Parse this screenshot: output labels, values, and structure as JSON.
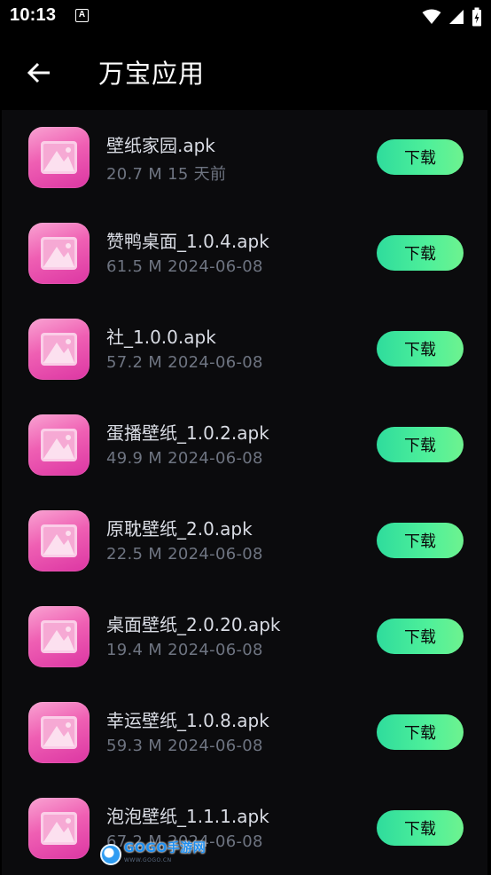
{
  "status_bar": {
    "time": "10:13",
    "notification_icon": "A"
  },
  "header": {
    "title": "万宝应用",
    "back_icon": "arrow-left-icon"
  },
  "items": [
    {
      "name": "壁纸家园.apk",
      "meta": "20.7 M  15 天前",
      "button": "下载"
    },
    {
      "name": "赞鸭桌面_1.0.4.apk",
      "meta": "61.5 M  2024-06-08",
      "button": "下载"
    },
    {
      "name": "社_1.0.0.apk",
      "meta": "57.2 M  2024-06-08",
      "button": "下载"
    },
    {
      "name": "蛋播壁纸_1.0.2.apk",
      "meta": "49.9 M  2024-06-08",
      "button": "下载"
    },
    {
      "name": "原耽壁纸_2.0.apk",
      "meta": "22.5 M  2024-06-08",
      "button": "下载"
    },
    {
      "name": "桌面壁纸_2.0.20.apk",
      "meta": "19.4 M  2024-06-08",
      "button": "下载"
    },
    {
      "name": "幸运壁纸_1.0.8.apk",
      "meta": "59.3 M  2024-06-08",
      "button": "下载"
    },
    {
      "name": "泡泡壁纸_1.1.1.apk",
      "meta": "67.2 M  2024-06-08",
      "button": "下载"
    }
  ],
  "watermark": {
    "text": "GOGO手游网",
    "sub": "WWW.GOGO.CN"
  },
  "colors": {
    "background": "#0b0b0d",
    "button_gradient_start": "#2fdc9c",
    "button_gradient_end": "#6ef28f",
    "icon_pink": "#ef5fb3",
    "title_text": "#ffffff",
    "name_text": "#d9dce4",
    "meta_text": "#6e7481"
  }
}
